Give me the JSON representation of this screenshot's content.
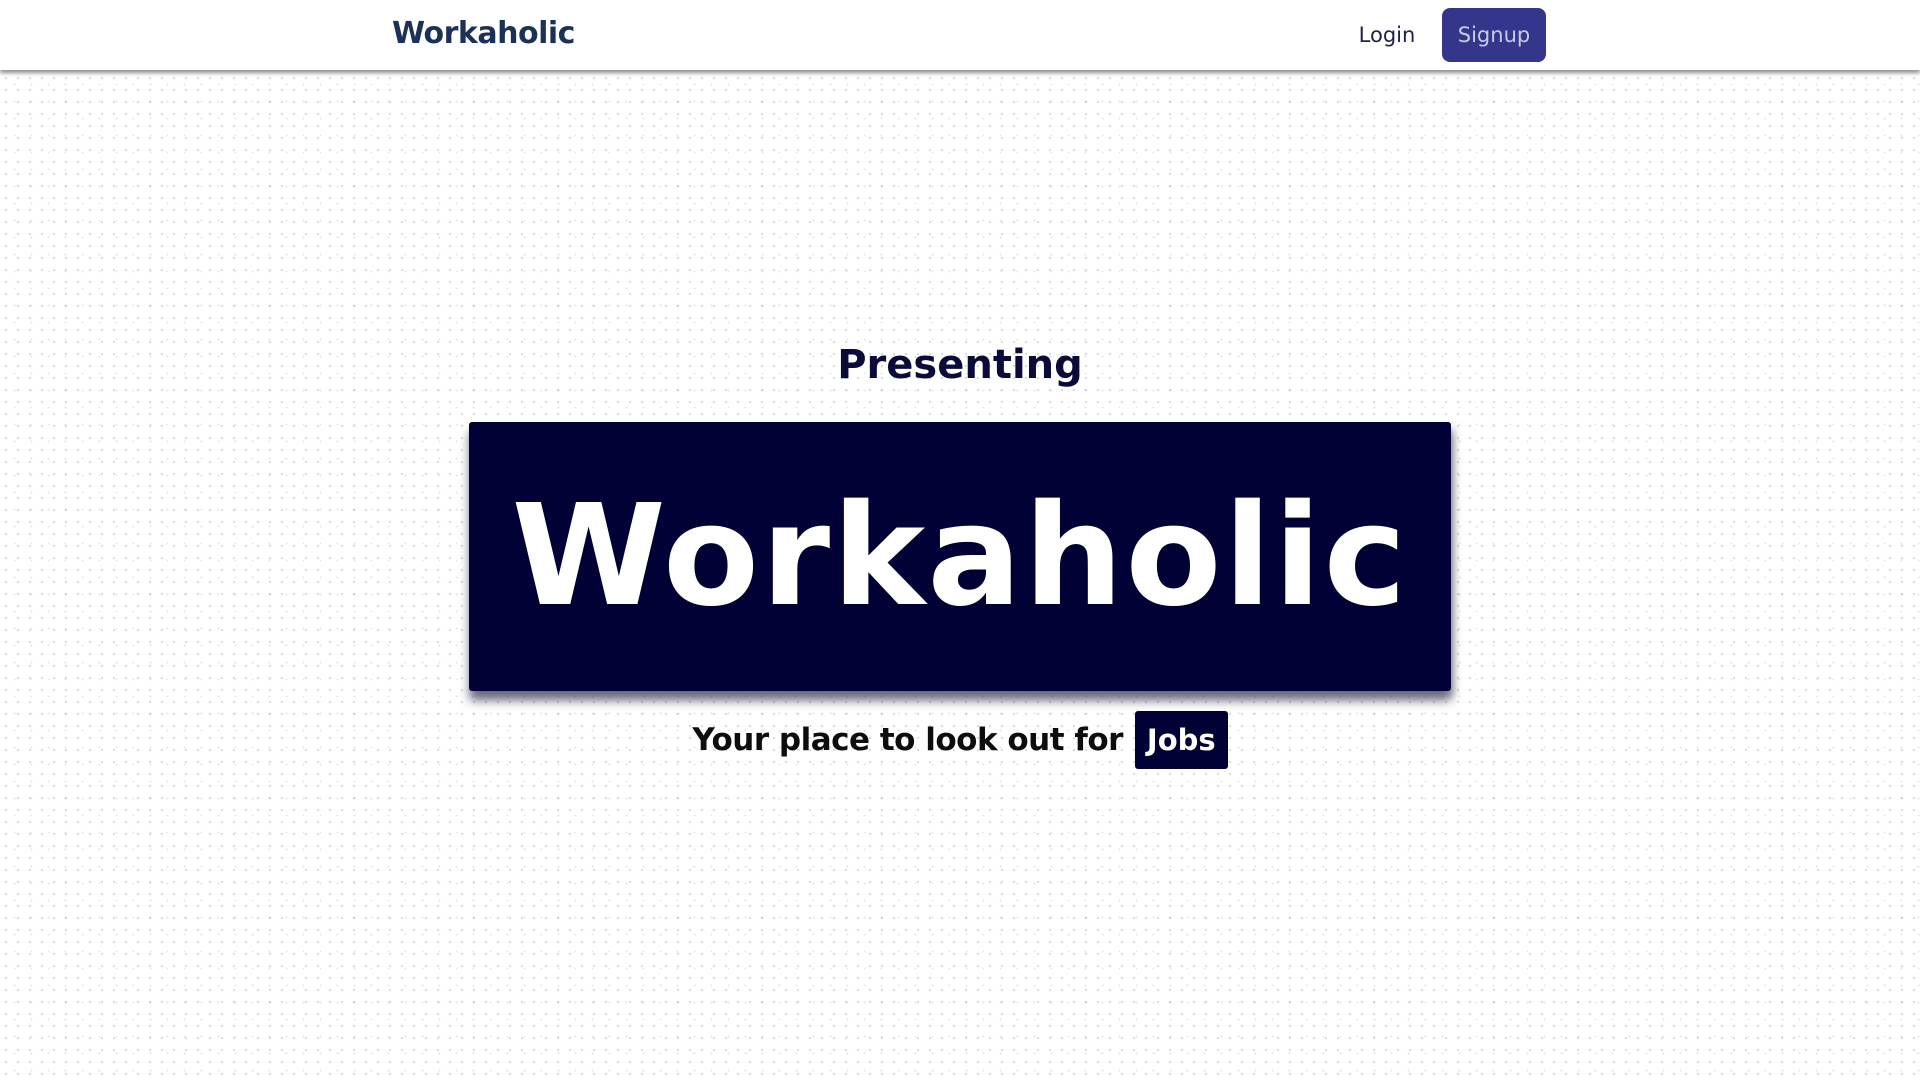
{
  "navbar": {
    "brand": "Workaholic",
    "login_label": "Login",
    "signup_label": "Signup"
  },
  "hero": {
    "presenting": "Presenting",
    "title": "Workaholic",
    "tagline": "Your place to look out for",
    "tagline_highlight": "Jobs"
  },
  "colors": {
    "brand": "#1b3157",
    "signup_button_bg": "#33368a",
    "hero_box_bg": "#010135",
    "hero_text": "#ffffff",
    "heading_text": "#0b0b3a"
  }
}
